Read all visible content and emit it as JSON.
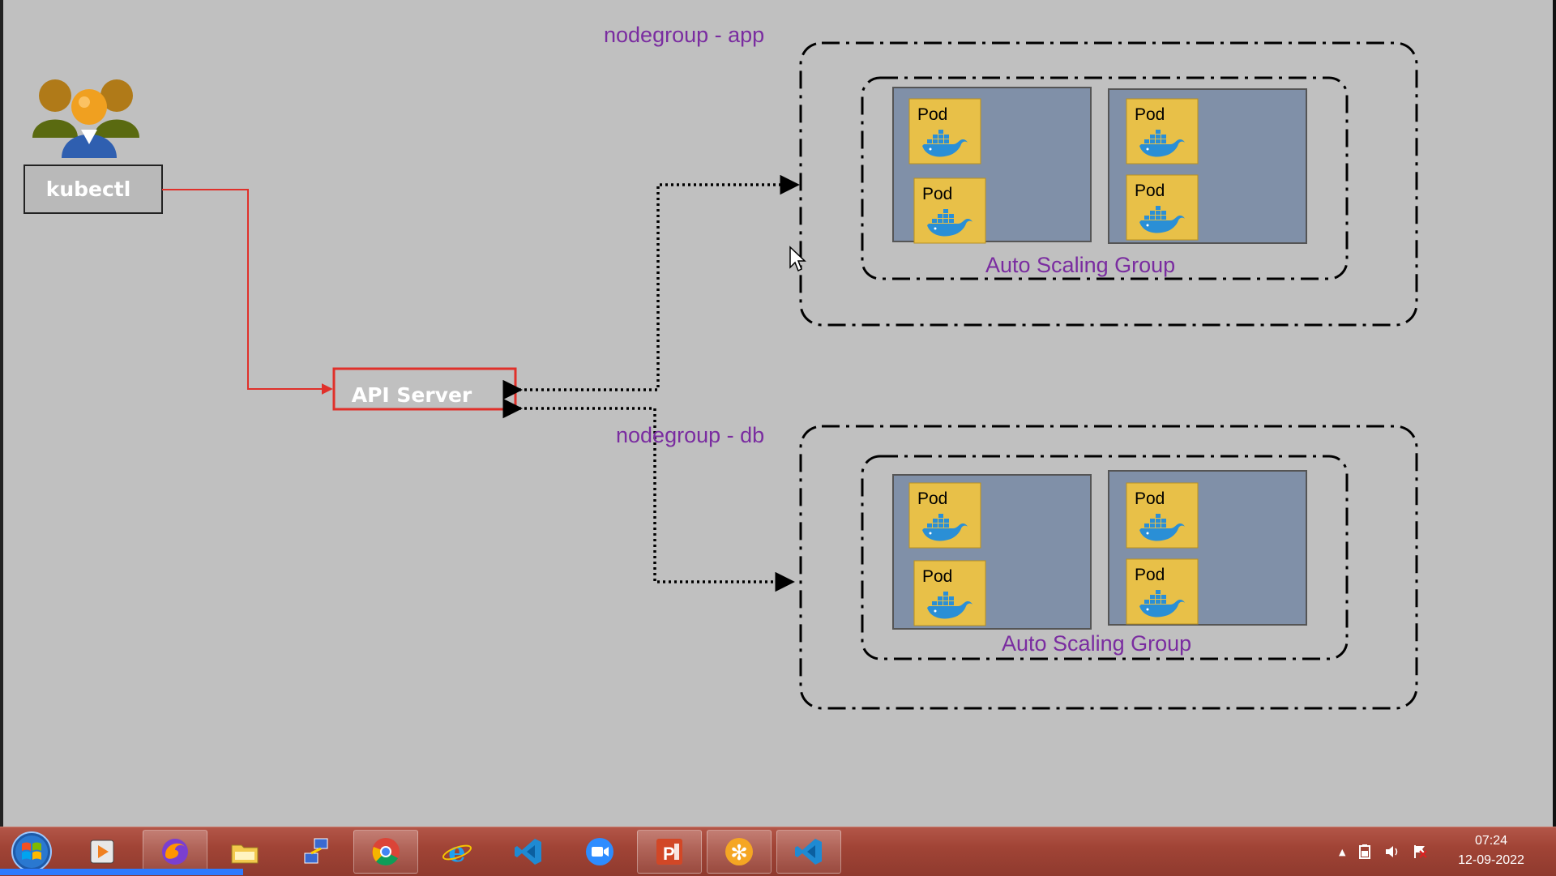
{
  "diagram": {
    "kubectl_label": "kubectl",
    "api_server_label": "API Server",
    "nodegroup_app_label": "nodegroup - app",
    "nodegroup_db_label": "nodegroup - db",
    "asg_label": "Auto Scaling Group",
    "pod_label": "Pod"
  },
  "taskbar": {
    "apps": [
      "media-player",
      "firefox",
      "file-explorer",
      "network-tool",
      "chrome",
      "internet-explorer",
      "vscode",
      "zoom",
      "powerpoint",
      "app-orange",
      "vscode-active"
    ],
    "tray_expand": "▲",
    "time": "07:24",
    "date": "12-09-2022"
  },
  "colors": {
    "slide_bg": "#c0c0c0",
    "purple_text": "#7a2ca0",
    "api_border": "#e0302a",
    "node_fill": "#8090a8",
    "pod_fill": "#e8c048"
  }
}
